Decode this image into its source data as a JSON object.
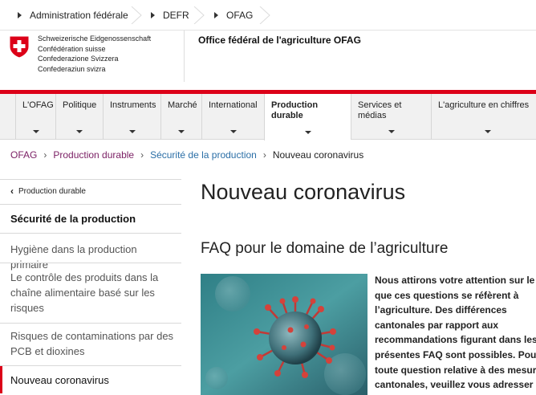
{
  "topbar": {
    "crumbs": [
      "Administration fédérale",
      "DEFR",
      "OFAG"
    ]
  },
  "header": {
    "fed_names": [
      "Schweizerische Eidgenossenschaft",
      "Confédération suisse",
      "Confederazione Svizzera",
      "Confederaziun svizra"
    ],
    "office": "Office fédéral de l'agriculture OFAG"
  },
  "nav": {
    "items": [
      {
        "label": "L'OFAG"
      },
      {
        "label": "Politique"
      },
      {
        "label": "Instruments"
      },
      {
        "label": "Marché"
      },
      {
        "label": "International"
      },
      {
        "label": "Production durable",
        "active": true
      },
      {
        "label": "Services et médias"
      },
      {
        "label": "L'agriculture en chiffres"
      }
    ]
  },
  "breadcrumb": {
    "items": [
      "OFAG",
      "Production durable",
      "Sécurité de la production",
      "Nouveau coronavirus"
    ],
    "colors": [
      "#7a1e63",
      "#7a1e63",
      "#2a6ea6",
      "#222222"
    ]
  },
  "sidebar": {
    "back_label": "Production durable",
    "section_title": "Sécurité de la production",
    "links": [
      "Hygiène dans la production primaire",
      "Le contrôle des produits dans la chaîne alimentaire basé sur les risques",
      "Risques de contaminations par des PCB et dioxines",
      "Nouveau coronavirus"
    ],
    "active_index": 3
  },
  "content": {
    "title": "Nouveau coronavirus",
    "subtitle": "FAQ pour le domaine de l’agriculture",
    "lead_lines": [
      "Nous attirons votre attention sur le fait",
      "que ces questions se réfèrent à",
      "l’agriculture. Des différences",
      "cantonales par rapport aux",
      "recommandations figurant dans les",
      "présentes FAQ sont possibles. Pour",
      "toute question relative à des mesures",
      "cantonales, veuillez vous adresser"
    ]
  },
  "colors": {
    "accent_red": "#dc0018",
    "link_purple": "#7a1e63",
    "link_blue": "#2a6ea6"
  }
}
